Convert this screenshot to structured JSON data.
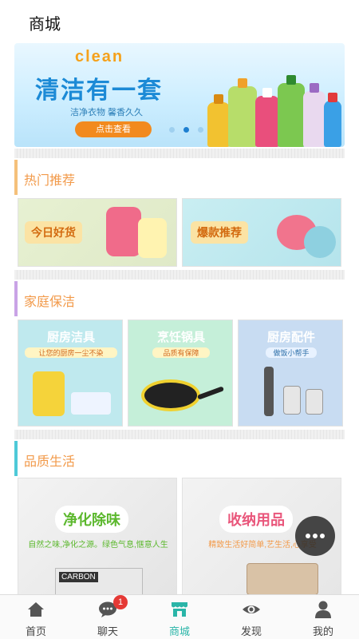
{
  "header": {
    "title": "商城"
  },
  "banner": {
    "brand_text": "clean",
    "headline": "清洁有一套",
    "subtitle": "洁净衣物 馨香久久",
    "cta_label": "点击查看"
  },
  "sections": [
    {
      "title": "热门推荐",
      "accent": "#f5c07a",
      "cards": [
        {
          "label": "今日好货"
        },
        {
          "label": "爆款推荐"
        }
      ]
    },
    {
      "title": "家庭保洁",
      "accent": "#c9a3e6",
      "cards": [
        {
          "label": "厨房洁具",
          "sub": "让您的厨房一尘不染"
        },
        {
          "label": "烹饪锅具",
          "sub": "品质有保障"
        },
        {
          "label": "厨房配件",
          "sub": "做饭小帮手"
        }
      ]
    },
    {
      "title": "品质生活",
      "accent": "#4ec9d8",
      "cards": [
        {
          "label": "净化除味",
          "sub": "自然之味,净化之源。绿色气息,惬意人生"
        },
        {
          "label": "收纳用品",
          "sub": "精致生活好简单,艺生活,心享受"
        }
      ]
    }
  ],
  "product_text": {
    "carbon": "CARBON"
  },
  "bottom_nav": {
    "tabs": [
      {
        "label": "首页",
        "icon": "home-icon"
      },
      {
        "label": "聊天",
        "icon": "chat-icon",
        "badge": "1"
      },
      {
        "label": "商城",
        "icon": "store-icon"
      },
      {
        "label": "发现",
        "icon": "eye-icon"
      },
      {
        "label": "我的",
        "icon": "person-icon"
      }
    ],
    "active_index": 2
  },
  "colors": {
    "active": "#2ab5a8",
    "badge": "#e53935",
    "cta": "#f28a1e"
  }
}
